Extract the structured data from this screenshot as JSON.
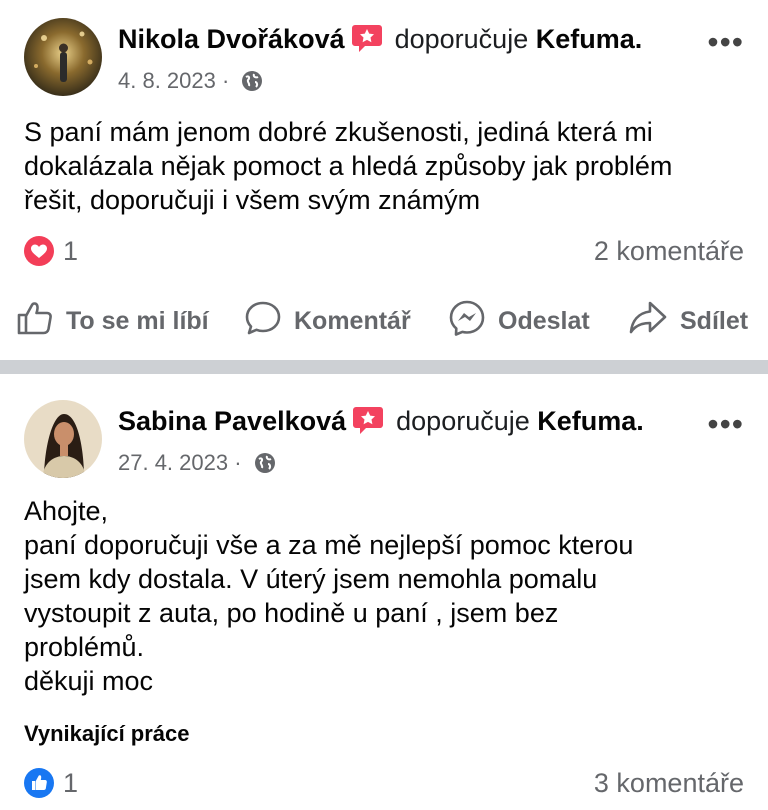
{
  "posts": [
    {
      "author": "Nikola Dvořáková",
      "recommends": "doporučuje",
      "page": "Kefuma.",
      "date": "4. 8. 2023",
      "separator": "·",
      "text_lines": [
        "S paní mám jenom dobré zkušenosti, jediná která mi",
        "dokalázala nějak pomoct a hledá způsoby jak problém",
        "řešit, doporučuji i všem svým známým"
      ],
      "reaction": "love",
      "reaction_count": "1",
      "comments": "2 komentáře"
    },
    {
      "author": "Sabina Pavelková",
      "recommends": "doporučuje",
      "page": "Kefuma.",
      "date": "27. 4. 2023",
      "separator": "·",
      "text_lines": [
        "Ahojte,",
        "paní doporučuji vše a za mě nejlepší pomoc kterou",
        "jsem kdy dostala. V úterý jsem nemohla pomalu",
        "vystoupit z auta, po hodině u paní , jsem bez",
        "problémů.",
        "děkuji moc"
      ],
      "tag": "Vynikající práce",
      "reaction": "like",
      "reaction_count": "1",
      "comments": "3 komentáře"
    }
  ],
  "actions": {
    "like": "To se mi líbí",
    "comment": "Komentář",
    "send": "Odeslat",
    "share": "Sdílet"
  },
  "more_label": "•••",
  "colors": {
    "love": "#f33e58",
    "like": "#1877f2",
    "badge": "#f3425f",
    "divider": "#cdd0d4",
    "muted": "#65676b"
  },
  "icons": [
    "recommend-badge-icon",
    "globe-icon",
    "heart-reaction-icon",
    "thumbs-up-reaction-icon",
    "like-icon",
    "comment-icon",
    "messenger-icon",
    "share-icon",
    "more-icon"
  ]
}
